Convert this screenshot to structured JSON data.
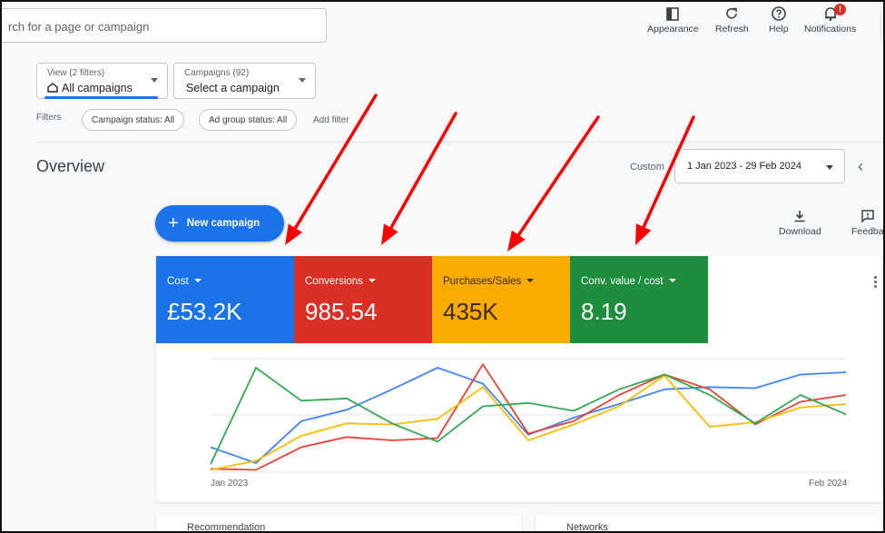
{
  "search": {
    "placeholder": "rch for a page or campaign"
  },
  "toolbar": {
    "appearance_label": "Appearance",
    "refresh_label": "Refresh",
    "help_label": "Help",
    "notifications_label": "Notifications",
    "notifications_badge": "!"
  },
  "view_selector": {
    "label": "View (2 filters)",
    "value": "All campaigns"
  },
  "campaign_selector": {
    "label": "Campaigns (92)",
    "value": "Select a campaign"
  },
  "filters": {
    "label": "Filters",
    "chips": [
      "Campaign status: All",
      "Ad group status: All"
    ],
    "add_label": "Add filter"
  },
  "page": {
    "title": "Overview"
  },
  "date": {
    "mode_label": "Custom",
    "range": "1 Jan 2023 - 29 Feb 2024"
  },
  "actions": {
    "new_campaign_label": "New campaign",
    "download_label": "Download",
    "feedback_label": "Feedba"
  },
  "metrics": [
    {
      "label": "Cost",
      "value": "£53.2K",
      "color": "#1a73e8"
    },
    {
      "label": "Conversions",
      "value": "985.54",
      "color": "#d93025"
    },
    {
      "label": "Purchases/Sales",
      "value": "435K",
      "color": "#f9ab00"
    },
    {
      "label": "Conv. value / cost",
      "value": "8.19",
      "color": "#1e8e3e"
    }
  ],
  "chart_data": {
    "type": "line",
    "x_tick_labels": [
      "Jan 2023",
      "Feb 2024"
    ],
    "series": [
      {
        "color": "#4285f4",
        "values": [
          0.22,
          0.08,
          0.45,
          0.55,
          0.73,
          0.92,
          0.78,
          0.33,
          0.48,
          0.6,
          0.73,
          0.75,
          0.74,
          0.86,
          0.88
        ]
      },
      {
        "color": "#ea4335",
        "values": [
          0.03,
          0.02,
          0.22,
          0.31,
          0.28,
          0.3,
          0.95,
          0.34,
          0.45,
          0.68,
          0.86,
          0.73,
          0.42,
          0.62,
          0.68
        ]
      },
      {
        "color": "#fbbc04",
        "values": [
          0.02,
          0.1,
          0.32,
          0.43,
          0.42,
          0.47,
          0.75,
          0.28,
          0.42,
          0.58,
          0.85,
          0.4,
          0.44,
          0.57,
          0.6
        ]
      },
      {
        "color": "#34a853",
        "values": [
          0.07,
          0.92,
          0.63,
          0.65,
          0.43,
          0.27,
          0.58,
          0.61,
          0.54,
          0.73,
          0.86,
          0.68,
          0.43,
          0.68,
          0.51
        ]
      }
    ]
  },
  "bottom_cards": [
    "Recommendation",
    "Networks"
  ],
  "annotation": {
    "arrow_color": "#ff0000"
  }
}
